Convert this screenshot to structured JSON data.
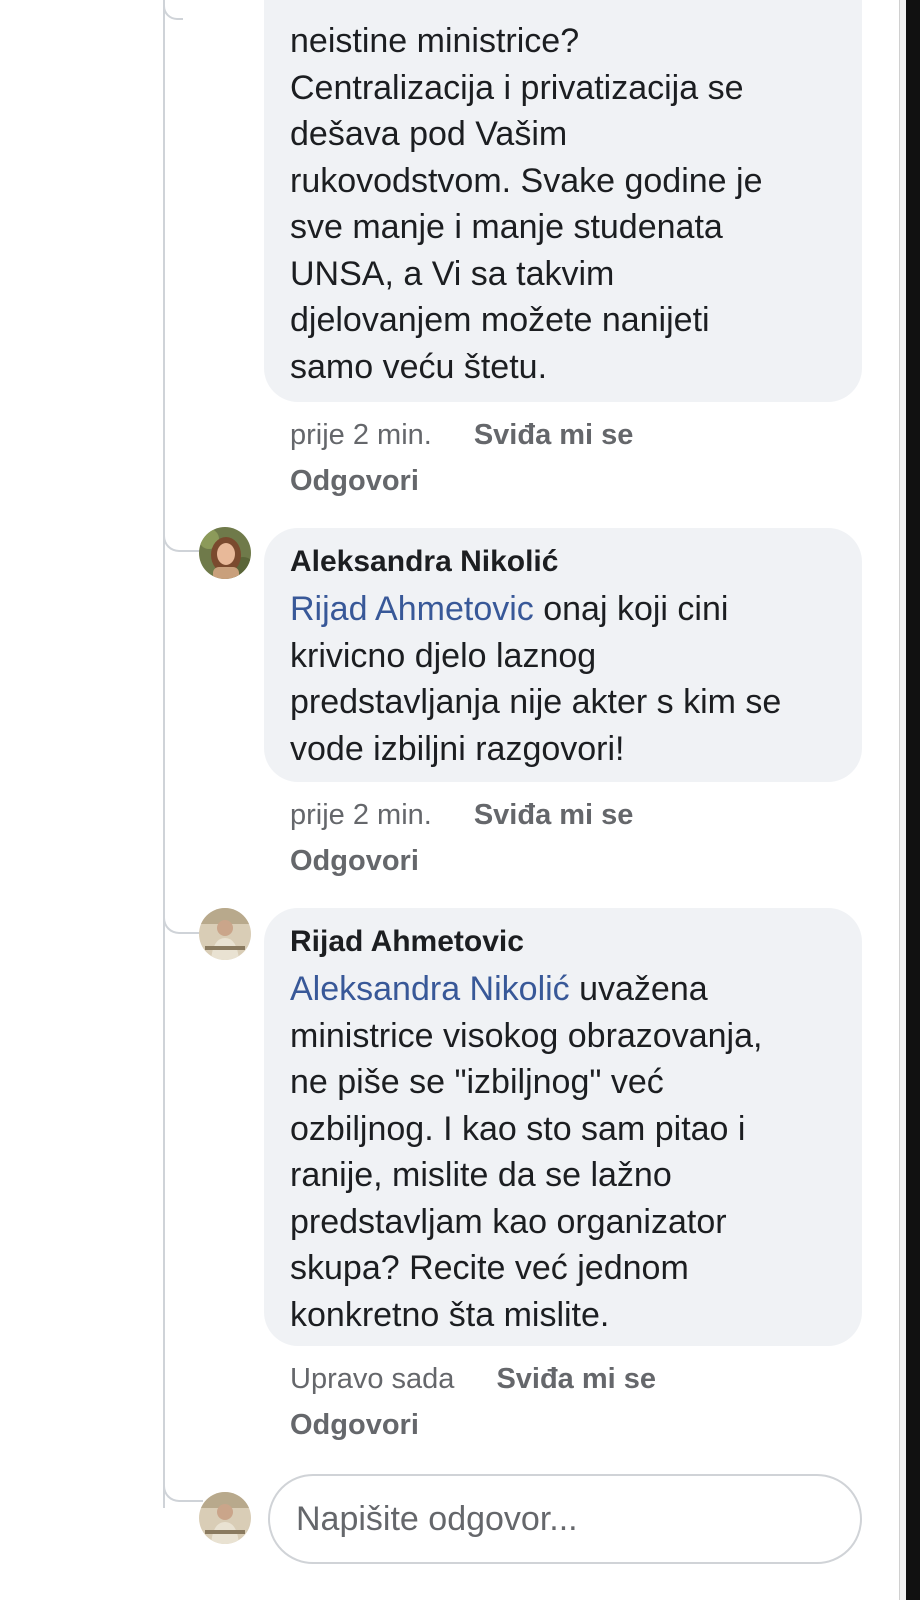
{
  "comments": [
    {
      "author": "",
      "mention": "",
      "text": "neistine ministrice?\nCentralizacija i privatizacija se\ndešava pod Vašim\nrukovodstvom. Svake godine je\nsve manje i manje studenata\nUNSA, a Vi sa takvim\ndjelovanjem možete nanijeti\nsamo veću štetu.",
      "time": "prije 2 min.",
      "like_label": "Sviđa mi se",
      "reply_label": "Odgovori"
    },
    {
      "author": "Aleksandra Nikolić",
      "mention": "Rijad Ahmetovic",
      "text": " onaj koji cini\nkrivicno djelo laznog\npredstavljanja nije akter s kim se\nvode izbiljni razgovori!",
      "time": "prije 2 min.",
      "like_label": "Sviđa mi se",
      "reply_label": "Odgovori",
      "avatar_icon": "profile-photo-woman"
    },
    {
      "author": "Rijad Ahmetovic",
      "mention": "Aleksandra Nikolić",
      "text": " uvažena\nministrice visokog obrazovanja,\nne piše se \"izbiljnog\" već\nozbiljnog. I kao sto sam pitao i\nranije, mislite da se lažno\npredstavljam kao organizator\nskupa? Recite već jednom\nkonkretno šta mislite.",
      "time": "Upravo sada",
      "like_label": "Sviđa mi se",
      "reply_label": "Odgovori",
      "avatar_icon": "profile-photo-man"
    }
  ],
  "reply_box": {
    "placeholder": "Napišite odgovor...",
    "avatar_icon": "profile-photo-man"
  },
  "colors": {
    "bubble": "#f0f2f5",
    "mention": "#385898",
    "meta_text": "#65676b",
    "thread_line": "#cfd3d8"
  }
}
